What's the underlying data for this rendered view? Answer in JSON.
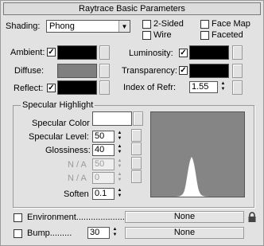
{
  "panel": {
    "title": "Raytrace Basic Parameters"
  },
  "shading": {
    "label": "Shading:",
    "value": "Phong",
    "options_visible": [
      "Phong"
    ]
  },
  "flags": {
    "two_sided": {
      "label": "2-Sided",
      "checked": false
    },
    "wire": {
      "label": "Wire",
      "checked": false
    },
    "face_map": {
      "label": "Face Map",
      "checked": false
    },
    "faceted": {
      "label": "Faceted",
      "checked": false
    }
  },
  "colors_left": {
    "ambient": {
      "label": "Ambient:",
      "checked": true,
      "color": "#000000"
    },
    "diffuse": {
      "label": "Diffuse:",
      "color": "#7f7f7f"
    },
    "reflect": {
      "label": "Reflect:",
      "checked": true,
      "color": "#000000"
    }
  },
  "colors_right": {
    "luminosity": {
      "label": "Luminosity:",
      "checked": true,
      "color": "#000000"
    },
    "transparency": {
      "label": "Transparency:",
      "checked": true,
      "color": "#000000"
    },
    "ior": {
      "label": "Index of Refr:",
      "value": "1.55"
    }
  },
  "specular": {
    "group_title": "Specular Highlight",
    "color_label": "Specular Color",
    "color": "#ffffff",
    "level_label": "Specular Level:",
    "level_value": "50",
    "glossiness_label": "Glossiness:",
    "glossiness_value": "40",
    "na1_label": "N / A",
    "na1_value": "50",
    "na2_label": "N / A",
    "na2_value": "0",
    "soften_label": "Soften",
    "soften_value": "0.1"
  },
  "maps": {
    "environment": {
      "label": "Environment",
      "checked": false,
      "button": "None",
      "lock_icon": "lock-icon"
    },
    "bump": {
      "label": "Bump",
      "checked": false,
      "amount": "30",
      "button": "None"
    }
  },
  "ui_colors": {
    "panel_bg": "#e2e2e2",
    "curve_bg": "#858585",
    "curve_fill": "#ffffff"
  }
}
